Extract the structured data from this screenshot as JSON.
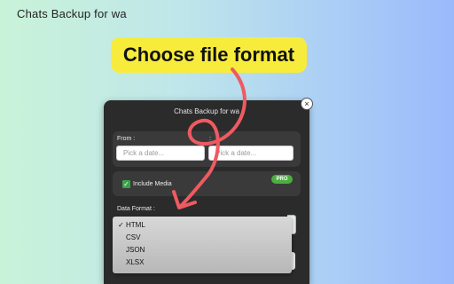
{
  "page_title": "Chats Backup for wa",
  "callout_text": "Choose file format",
  "popup": {
    "title": "Chats Backup for wa",
    "close_glyph": "×",
    "from_label": "From :",
    "to_label": ":",
    "from_placeholder": "Pick a date...",
    "to_placeholder": "Pick a date...",
    "include_media_label": "Include Media",
    "include_media_checked": true,
    "pro_badge": "PRO",
    "data_format_label": "Data Format :"
  },
  "dropdown": {
    "selected": "HTML",
    "check_glyph": "✓",
    "options": [
      "HTML",
      "CSV",
      "JSON",
      "XLSX"
    ]
  },
  "colors": {
    "callout": "#f7ec3c",
    "arrow": "#ef5a61",
    "popup_bg": "#2b2b2b",
    "pro_badge": "#4cae3f"
  },
  "icons": {
    "checkbox": "check-icon",
    "close": "close-icon",
    "annotation": "curved-arrow"
  }
}
